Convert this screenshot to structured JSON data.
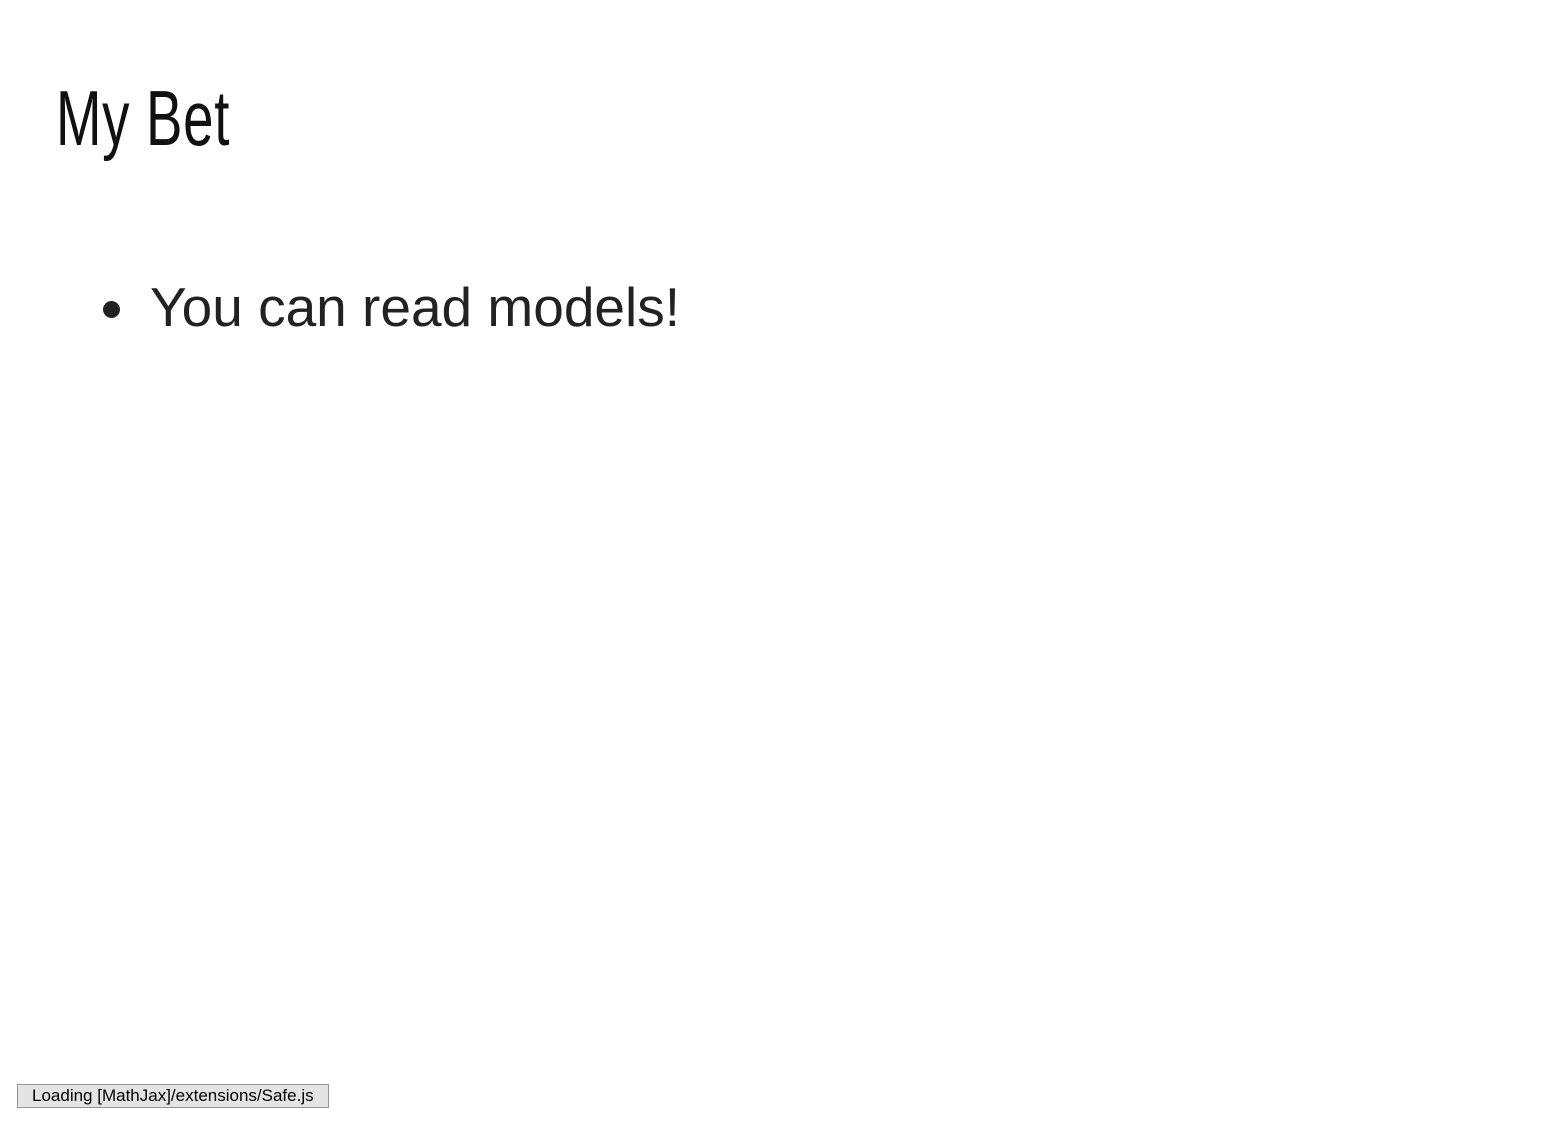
{
  "slide": {
    "title": "My Bet",
    "bullets": [
      "You can read models!"
    ]
  },
  "status": {
    "message": "Loading [MathJax]/extensions/Safe.js"
  },
  "colors": {
    "background": "#ffffff",
    "title_text": "#111111",
    "body_text": "#222222",
    "status_bg": "#e4e4e4",
    "status_border": "#959595"
  }
}
